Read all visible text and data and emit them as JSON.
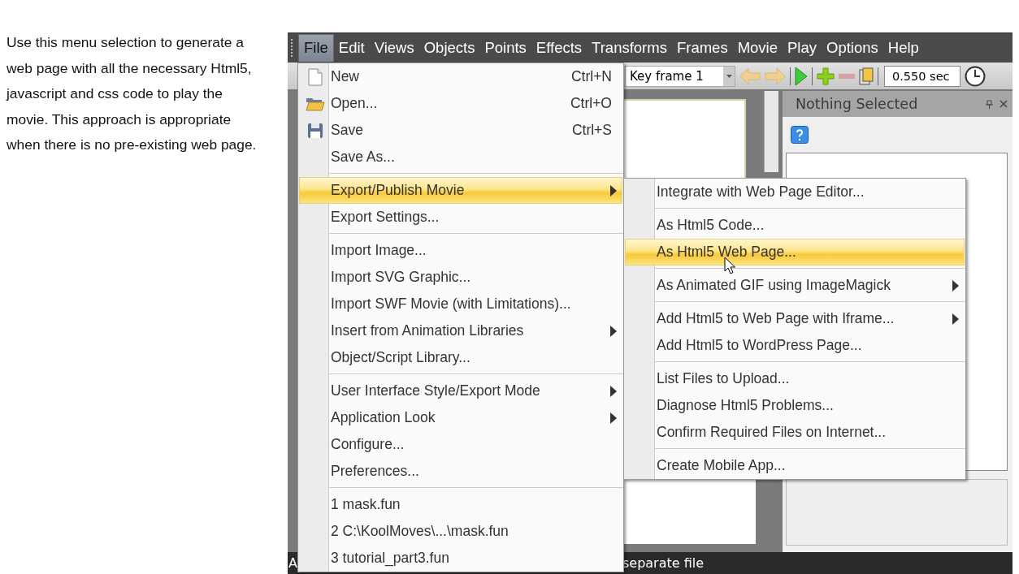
{
  "instructions": "Use this menu selection to generate a web page with all the necessary Html5, javascript and css code to play the movie. This approach is appropriate when there is no pre-existing web page.",
  "menu_bar": [
    {
      "label": "File",
      "selected": true
    },
    {
      "label": "Edit",
      "selected": false
    },
    {
      "label": "Views",
      "selected": false
    },
    {
      "label": "Objects",
      "selected": false
    },
    {
      "label": "Points",
      "selected": false
    },
    {
      "label": "Effects",
      "selected": false
    },
    {
      "label": "Transforms",
      "selected": false
    },
    {
      "label": "Frames",
      "selected": false
    },
    {
      "label": "Movie",
      "selected": false
    },
    {
      "label": "Play",
      "selected": false
    },
    {
      "label": "Options",
      "selected": false
    },
    {
      "label": "Help",
      "selected": false
    }
  ],
  "toolbar": {
    "frame_select": {
      "value": "Key frame 1"
    },
    "time_field": {
      "value": "0.550 sec"
    }
  },
  "panel": {
    "title": "Nothing Selected"
  },
  "status_bar": [
    "A",
    "separate file"
  ],
  "file_menu": [
    {
      "kind": "item",
      "label": "New",
      "shortcut": "Ctrl+N",
      "selected": false,
      "has_submenu": false
    },
    {
      "kind": "item",
      "label": "Open...",
      "shortcut": "Ctrl+O",
      "selected": false,
      "has_submenu": false
    },
    {
      "kind": "item",
      "label": "Save",
      "shortcut": "Ctrl+S",
      "selected": false,
      "has_submenu": false
    },
    {
      "kind": "item",
      "label": "Save As...",
      "selected": false,
      "has_submenu": false
    },
    {
      "kind": "separator"
    },
    {
      "kind": "item",
      "label": "Export/Publish Movie",
      "selected": true,
      "has_submenu": true
    },
    {
      "kind": "item",
      "label": "Export Settings...",
      "selected": false,
      "has_submenu": false
    },
    {
      "kind": "separator"
    },
    {
      "kind": "item",
      "label": "Import Image...",
      "selected": false,
      "has_submenu": false
    },
    {
      "kind": "item",
      "label": "Import SVG Graphic...",
      "selected": false,
      "has_submenu": false
    },
    {
      "kind": "item",
      "label": "Import SWF Movie (with Limitations)...",
      "selected": false,
      "has_submenu": false
    },
    {
      "kind": "item",
      "label": "Insert from Animation Libraries",
      "selected": false,
      "has_submenu": true
    },
    {
      "kind": "item",
      "label": "Object/Script Library...",
      "selected": false,
      "has_submenu": false
    },
    {
      "kind": "separator"
    },
    {
      "kind": "item",
      "label": "User Interface Style/Export Mode",
      "selected": false,
      "has_submenu": true
    },
    {
      "kind": "item",
      "label": "Application Look",
      "selected": false,
      "has_submenu": true
    },
    {
      "kind": "item",
      "label": "Configure...",
      "selected": false,
      "has_submenu": false
    },
    {
      "kind": "item",
      "label": "Preferences...",
      "selected": false,
      "has_submenu": false
    },
    {
      "kind": "separator"
    },
    {
      "kind": "item",
      "label": "1 mask.fun",
      "selected": false,
      "has_submenu": false
    },
    {
      "kind": "item",
      "label": "2 C:\\KoolMoves\\...\\mask.fun",
      "selected": false,
      "has_submenu": false
    },
    {
      "kind": "item",
      "label": "3 tutorial_part3.fun",
      "selected": false,
      "has_submenu": false
    }
  ],
  "export_submenu": [
    {
      "kind": "item",
      "label": "Integrate with Web Page Editor...",
      "selected": false,
      "has_submenu": false
    },
    {
      "kind": "separator"
    },
    {
      "kind": "item",
      "label": "As Html5 Code...",
      "selected": false,
      "has_submenu": false
    },
    {
      "kind": "item",
      "label": "As Html5 Web Page...",
      "selected": true,
      "has_submenu": false
    },
    {
      "kind": "separator"
    },
    {
      "kind": "item",
      "label": "As Animated GIF using ImageMagick",
      "selected": false,
      "has_submenu": true
    },
    {
      "kind": "separator"
    },
    {
      "kind": "item",
      "label": "Add Html5 to Web Page with Iframe...",
      "selected": false,
      "has_submenu": true
    },
    {
      "kind": "item",
      "label": "Add Html5 to WordPress Page...",
      "selected": false,
      "has_submenu": false
    },
    {
      "kind": "separator"
    },
    {
      "kind": "item",
      "label": "List Files to Upload...",
      "selected": false,
      "has_submenu": false
    },
    {
      "kind": "item",
      "label": "Diagnose Html5 Problems...",
      "selected": false,
      "has_submenu": false
    },
    {
      "kind": "item",
      "label": "Confirm Required Files on Internet...",
      "selected": false,
      "has_submenu": false
    },
    {
      "kind": "separator"
    },
    {
      "kind": "item",
      "label": "Create Mobile App...",
      "selected": false,
      "has_submenu": false
    }
  ]
}
